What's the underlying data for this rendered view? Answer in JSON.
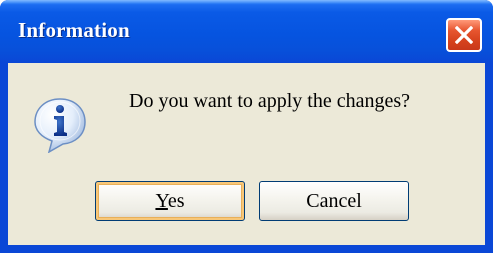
{
  "window": {
    "title": "Information",
    "close_icon": "close-icon",
    "colors": {
      "titlebar": "#0654e0",
      "client": "#ece9d8",
      "close_button": "#e7552f"
    }
  },
  "dialog": {
    "icon": "information-icon",
    "message": "Do you want to apply the changes?"
  },
  "buttons": {
    "yes": {
      "accelerator": "Y",
      "rest": "es"
    },
    "cancel": {
      "label": "Cancel"
    }
  }
}
